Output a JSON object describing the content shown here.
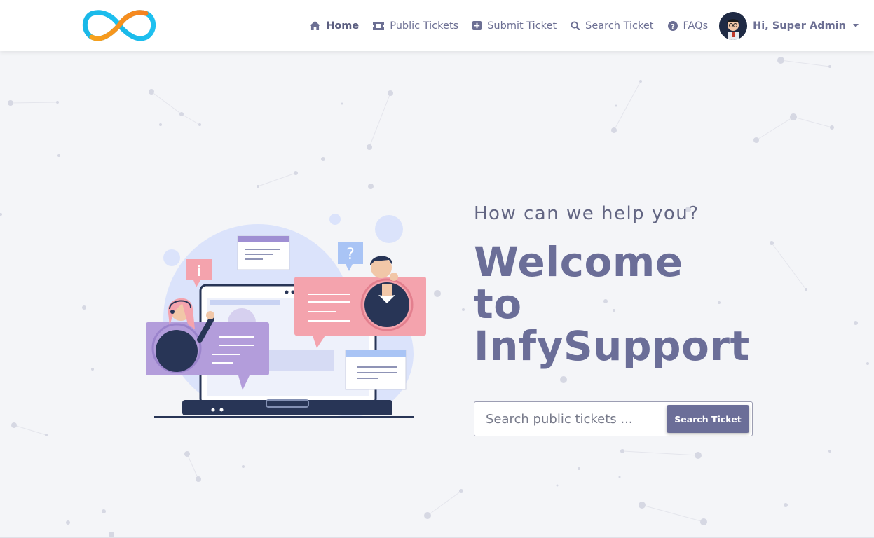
{
  "brand": {
    "logo_icon": "infinity-logo"
  },
  "nav": {
    "items": [
      {
        "label": "Home",
        "icon": "home-icon",
        "active": true
      },
      {
        "label": "Public Tickets",
        "icon": "ticket-icon"
      },
      {
        "label": "Submit Ticket",
        "icon": "plus-square-icon"
      },
      {
        "label": "Search Ticket",
        "icon": "search-icon"
      },
      {
        "label": "FAQs",
        "icon": "question-circle-icon"
      }
    ],
    "user": {
      "greeting": "Hi, Super Admin",
      "avatar_icon": "user-avatar"
    }
  },
  "hero": {
    "subtitle": "How can we help you?",
    "title_line1": "Welcome",
    "title_line2": "to",
    "title_line3": "InfySupport",
    "search": {
      "placeholder": "Search public tickets ...",
      "value": "",
      "button_label": "Search Ticket"
    }
  },
  "colors": {
    "accent": "#6b6e98",
    "background": "#f4f5f8",
    "illustration_purple": "#b39ddb",
    "illustration_pink": "#f4a3ad",
    "illustration_navy": "#283556"
  }
}
